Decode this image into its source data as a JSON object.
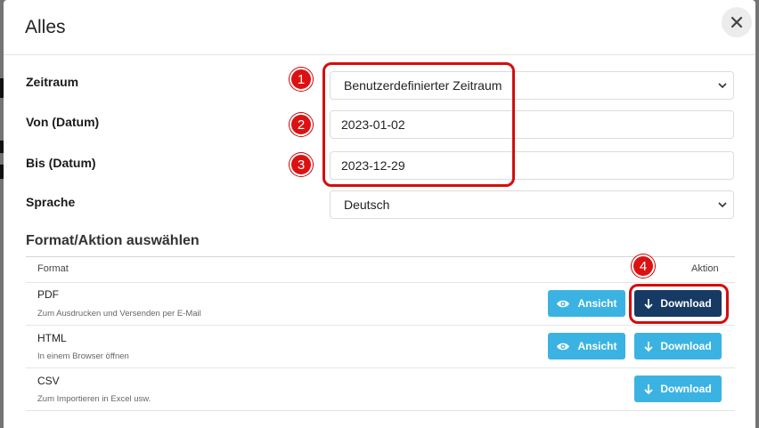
{
  "modal": {
    "title": "Alles"
  },
  "form": {
    "period_label": "Zeitraum",
    "period_value": "Benutzerdefinierter Zeitraum",
    "from_label": "Von (Datum)",
    "from_value": "2023-01-02",
    "to_label": "Bis (Datum)",
    "to_value": "2023-12-29",
    "language_label": "Sprache",
    "language_value": "Deutsch"
  },
  "markers": [
    "1",
    "2",
    "3",
    "4"
  ],
  "section": {
    "title": "Format/Aktion auswählen",
    "col_format": "Format",
    "col_action": "Aktion"
  },
  "rows": [
    {
      "name": "PDF",
      "desc": "Zum Ausdrucken und Versenden per E-Mail",
      "view_label": "Ansicht",
      "download_label": "Download"
    },
    {
      "name": "HTML",
      "desc": "In einem Browser öffnen",
      "view_label": "Ansicht",
      "download_label": "Download"
    },
    {
      "name": "CSV",
      "desc": "Zum Importieren in Excel usw.",
      "download_label": "Download"
    }
  ],
  "colors": {
    "accent_light": "#3bb3e2",
    "accent_dark": "#163a63",
    "annotation": "#d40d0d"
  }
}
